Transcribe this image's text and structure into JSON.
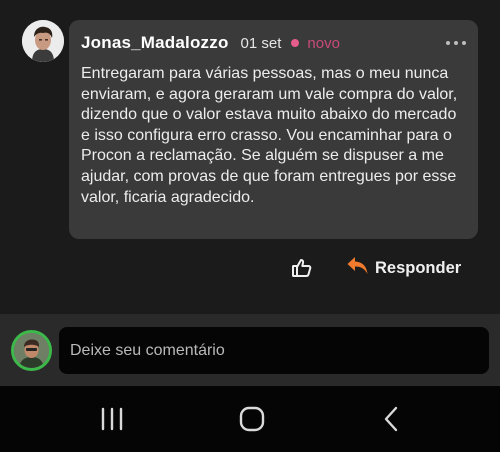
{
  "comment": {
    "author": "Jonas_Madalozzo",
    "date": "01 set",
    "badge": "novo",
    "text": "Entregaram para várias pessoas, mas o meu nunca enviaram, e agora geraram um vale compra do valor, dizendo que o valor estava muito abaixo do mercado e isso configura erro crasso. Vou encaminhar para o Procon a reclamação. Se alguém se dispuser a me ajudar, com provas de que foram entregues por esse valor, ficaria agradecido.",
    "more_icon": "more-horizontal-icon"
  },
  "actions": {
    "like_icon": "thumbs-up-icon",
    "reply_icon": "reply-arrow-icon",
    "reply_label": "Responder"
  },
  "composer": {
    "placeholder": "Deixe seu comentário"
  },
  "navbar": {
    "recents_icon": "recent-apps-icon",
    "home_icon": "home-icon",
    "back_icon": "back-icon"
  },
  "colors": {
    "badge": "#c94a7c",
    "reply_accent": "#f07a2e",
    "avatar_ring": "#3db84a"
  }
}
